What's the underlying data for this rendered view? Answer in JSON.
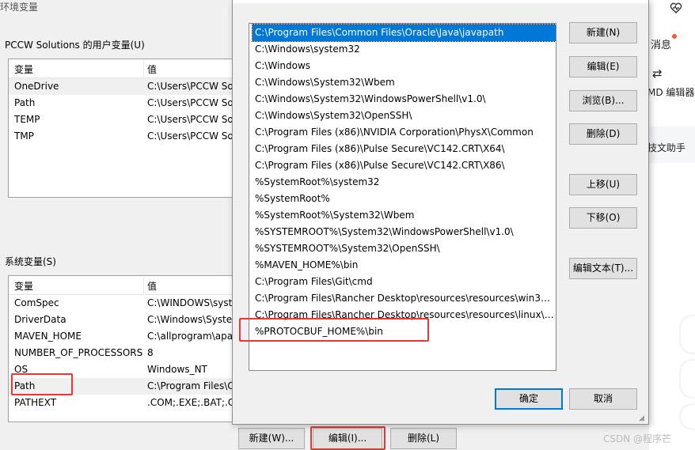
{
  "background_dialog": {
    "title": "环境变量",
    "user_section_label": "PCCW Solutions 的用户变量(U)",
    "user_columns": [
      "变量",
      "值"
    ],
    "user_vars": [
      {
        "name": "OneDrive",
        "value": "C:\\Users\\PCCW So"
      },
      {
        "name": "Path",
        "value": "C:\\Users\\PCCW So"
      },
      {
        "name": "TEMP",
        "value": "C:\\Users\\PCCW So"
      },
      {
        "name": "TMP",
        "value": "C:\\Users\\PCCW So"
      }
    ],
    "system_section_label": "系统变量(S)",
    "system_columns": [
      "变量",
      "值"
    ],
    "system_vars": [
      {
        "name": "ComSpec",
        "value": "C:\\WINDOWS\\syst"
      },
      {
        "name": "DriverData",
        "value": "C:\\Windows\\Syster"
      },
      {
        "name": "MAVEN_HOME",
        "value": "C:\\allprogram\\apa"
      },
      {
        "name": "NUMBER_OF_PROCESSORS",
        "value": "8"
      },
      {
        "name": "OS",
        "value": "Windows_NT"
      },
      {
        "name": "Path",
        "value": "C:\\Program Files\\C"
      },
      {
        "name": "PATHEXT",
        "value": ".COM;.EXE;.BAT;.CN"
      }
    ],
    "buttons": {
      "new": "新建(W)...",
      "edit": "编辑(I)...",
      "delete": "删除(L)"
    }
  },
  "edit_dialog": {
    "paths": [
      "C:\\Program Files\\Common Files\\Oracle\\Java\\javapath",
      "C:\\Windows\\system32",
      "C:\\Windows",
      "C:\\Windows\\System32\\Wbem",
      "C:\\Windows\\System32\\WindowsPowerShell\\v1.0\\",
      "C:\\Windows\\System32\\OpenSSH\\",
      "C:\\Program Files (x86)\\NVIDIA Corporation\\PhysX\\Common",
      "C:\\Program Files (x86)\\Pulse Secure\\VC142.CRT\\X64\\",
      "C:\\Program Files (x86)\\Pulse Secure\\VC142.CRT\\X86\\",
      "%SystemRoot%\\system32",
      "%SystemRoot%",
      "%SystemRoot%\\System32\\Wbem",
      "%SYSTEMROOT%\\System32\\WindowsPowerShell\\v1.0\\",
      "%SYSTEMROOT%\\System32\\OpenSSH\\",
      "%MAVEN_HOME%\\bin",
      "C:\\Program Files\\Git\\cmd",
      "C:\\Program Files\\Rancher Desktop\\resources\\resources\\win32\\...",
      "C:\\Program Files\\Rancher Desktop\\resources\\resources\\linux\\b...",
      "%PROTOCBUF_HOME%\\bin"
    ],
    "selected_index": 0,
    "buttons": {
      "new": "新建(N)",
      "edit": "编辑(E)",
      "browse": "浏览(B)...",
      "delete": "删除(D)",
      "move_up": "上移(U)",
      "move_down": "下移(O)",
      "edit_text": "编辑文本(T)...",
      "ok": "确定",
      "cancel": "取消"
    }
  },
  "right_page": {
    "messages": "消息",
    "md_editor": "MD 编辑器",
    "assistant": "技文助手",
    "watermark": "CSDN @程序芒"
  },
  "colors": {
    "selection": "#0078d7",
    "highlight": "#e53935"
  }
}
